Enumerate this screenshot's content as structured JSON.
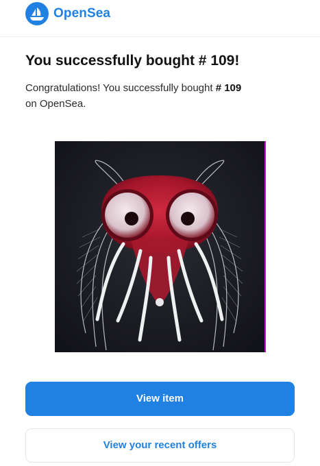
{
  "brand": {
    "name": "OpenSea",
    "logo_icon": "opensea-boat-icon",
    "color": "#2081e2"
  },
  "email": {
    "title": "You successfully bought # 109!",
    "message_prefix": "Congratulations! You successfully bought",
    "item_number": "# 109",
    "message_suffix": "on OpenSea."
  },
  "nft_image": {
    "description_icon": "nft-creature-image",
    "background_color": "#1b1c22",
    "accent_color": "#c0182e"
  },
  "actions": {
    "view_item_label": "View item",
    "view_offers_label": "View your recent offers"
  }
}
